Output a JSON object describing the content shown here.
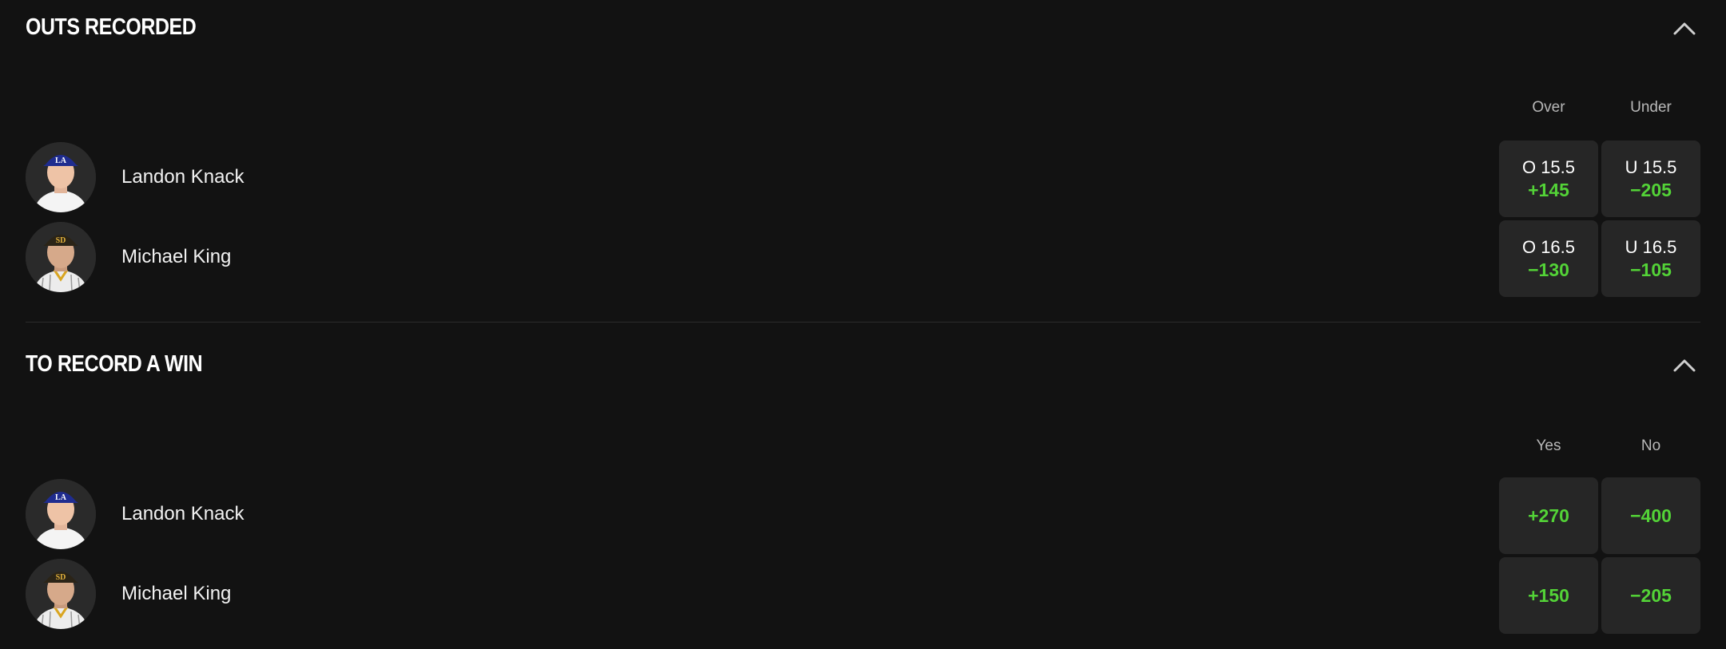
{
  "colors": {
    "background": "#121212",
    "button": "#262626",
    "price": "#53d337"
  },
  "sections": [
    {
      "title": "OUTS RECORDED",
      "collapse_icon": "chevron-up-icon",
      "columns": [
        "Over",
        "Under"
      ],
      "rows": [
        {
          "player": "Landon Knack",
          "team": "dodgers",
          "odds": [
            {
              "line": "O 15.5",
              "price": "+145"
            },
            {
              "line": "U 15.5",
              "price": "−205"
            }
          ]
        },
        {
          "player": "Michael King",
          "team": "padres",
          "odds": [
            {
              "line": "O 16.5",
              "price": "−130"
            },
            {
              "line": "U 16.5",
              "price": "−105"
            }
          ]
        }
      ]
    },
    {
      "title": "TO RECORD A WIN",
      "collapse_icon": "chevron-up-icon",
      "columns": [
        "Yes",
        "No"
      ],
      "rows": [
        {
          "player": "Landon Knack",
          "team": "dodgers",
          "odds": [
            {
              "price": "+270"
            },
            {
              "price": "−400"
            }
          ]
        },
        {
          "player": "Michael King",
          "team": "padres",
          "odds": [
            {
              "price": "+150"
            },
            {
              "price": "−205"
            }
          ]
        }
      ]
    }
  ]
}
